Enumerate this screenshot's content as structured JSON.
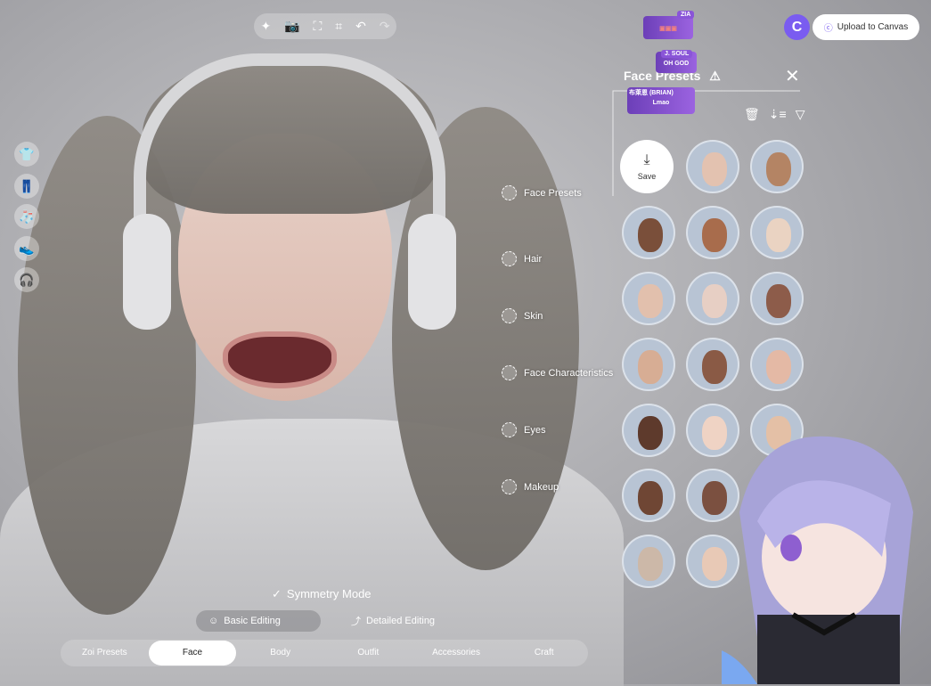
{
  "toolbar": {
    "icons": [
      "sparkle-icon",
      "camera-icon",
      "focus-icon",
      "scan-icon",
      "undo-icon",
      "redo-icon"
    ]
  },
  "left_categories": [
    "top-icon",
    "bottom-icon",
    "socks-icon",
    "shoes-icon",
    "headphone-icon"
  ],
  "face_menu": [
    "Face Presets",
    "Hair",
    "Skin",
    "Face Characteristics",
    "Eyes",
    "Makeup"
  ],
  "panel": {
    "title": "Face Presets",
    "save_label": "Save"
  },
  "upload": {
    "label": "Upload to Canvas",
    "accent": "#7a5cf0"
  },
  "chat": [
    {
      "name": "ZIA",
      "msg": "▣▣▣"
    },
    {
      "name": "J. SOUL",
      "msg": "OH GOD"
    },
    {
      "name": "布萊恩 (BRIAN)",
      "msg": "Lmao"
    }
  ],
  "symmetry": "Symmetry Mode",
  "editing": {
    "basic": "Basic Editing",
    "detailed": "Detailed Editing"
  },
  "tabs": [
    "Zoi Presets",
    "Face",
    "Body",
    "Outfit",
    "Accessories",
    "Craft"
  ],
  "active_tab": "Face",
  "presets": [
    "#e3c2b0",
    "#b48464",
    "#7a4f3a",
    "#a86c4c",
    "#ead3c2",
    "#e2c0ad",
    "#e7cfc4",
    "#8d5c4a",
    "#d7ad94",
    "#8a5a45",
    "#e4b9a5",
    "#5e3a2c",
    "#efd3c4",
    "#e4c0a6",
    "#6f4634",
    "#7b5040",
    "#e6c5b2",
    "#ccb8a8",
    "#e8c9b6",
    "#d6b098",
    "#c9a58d"
  ]
}
